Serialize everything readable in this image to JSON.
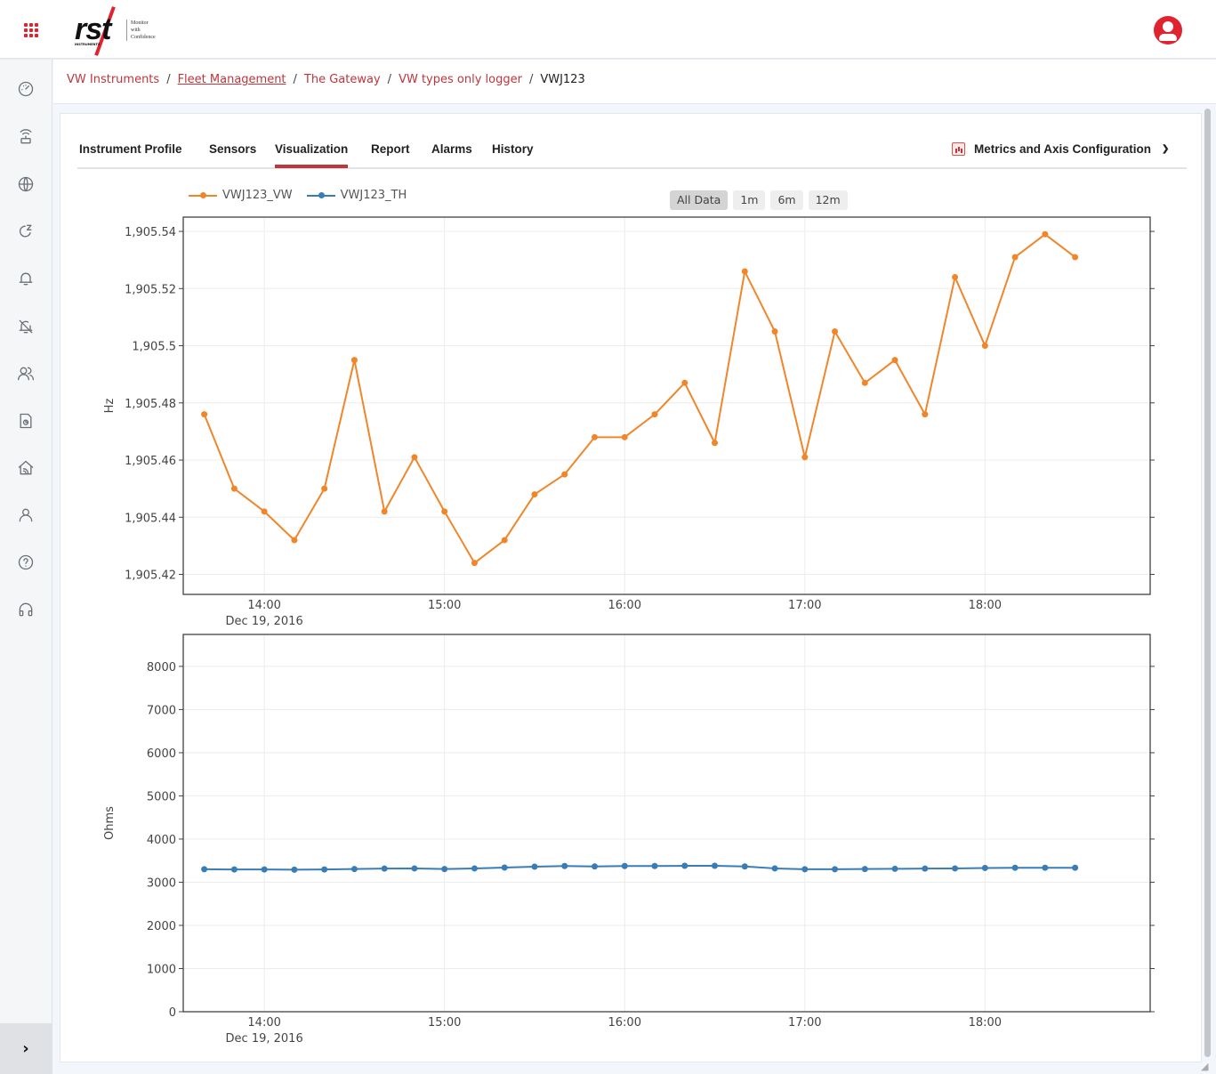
{
  "header": {
    "apps_icon": "grid-icon",
    "logo": {
      "text": "rst",
      "subtext": "INSTRUMENTS",
      "tagline": [
        "Monitor",
        "with",
        "Confidence"
      ]
    },
    "user_icon": "user-circle-icon"
  },
  "sidebar": {
    "items": [
      {
        "id": "dashboard",
        "icon": "gauge-icon"
      },
      {
        "id": "gateway",
        "icon": "router-icon"
      },
      {
        "id": "network",
        "icon": "globe-icon"
      },
      {
        "id": "sleep",
        "icon": "refresh-sleep-icon"
      },
      {
        "id": "alarms",
        "icon": "bell-icon"
      },
      {
        "id": "alarms-off",
        "icon": "bell-off-icon"
      },
      {
        "id": "users",
        "icon": "users-icon"
      },
      {
        "id": "reports",
        "icon": "file-chart-icon"
      },
      {
        "id": "sites",
        "icon": "home-wifi-icon"
      },
      {
        "id": "profile",
        "icon": "user-icon"
      },
      {
        "id": "help",
        "icon": "help-circle-icon"
      },
      {
        "id": "support",
        "icon": "headset-icon"
      }
    ],
    "toggle_label": "›"
  },
  "breadcrumb": [
    {
      "label": "VW Instruments",
      "link": true,
      "underline": false
    },
    {
      "label": "Fleet Management",
      "link": true,
      "underline": true
    },
    {
      "label": "The Gateway",
      "link": true,
      "underline": false
    },
    {
      "label": "VW types only logger",
      "link": true,
      "underline": false
    },
    {
      "label": "VWJ123",
      "link": false,
      "underline": false
    }
  ],
  "tabs": [
    {
      "label": "Instrument Profile",
      "active": false
    },
    {
      "label": "Sensors",
      "active": false
    },
    {
      "label": "Visualization",
      "active": true
    },
    {
      "label": "Report",
      "active": false
    },
    {
      "label": "Alarms",
      "active": false
    },
    {
      "label": "History",
      "active": false
    }
  ],
  "metrics_menu": {
    "label": "Metrics and Axis Configuration",
    "icon": "bar-chart-icon",
    "chevron": "chevron-down-icon"
  },
  "range_buttons": [
    {
      "label": "All Data",
      "selected": true
    },
    {
      "label": "1m",
      "selected": false
    },
    {
      "label": "6m",
      "selected": false
    },
    {
      "label": "12m",
      "selected": false
    }
  ],
  "colors": {
    "accent": "#c0353c",
    "vw": "#f0862a",
    "th": "#3a7db5"
  },
  "chart_data": [
    {
      "type": "line",
      "title": "",
      "xlabel": "",
      "ylabel": "Hz",
      "x_date_label": "Dec 19, 2016",
      "xticks": [
        "14:00",
        "15:00",
        "16:00",
        "17:00",
        "18:00"
      ],
      "xlim": [
        "13:33",
        "18:55"
      ],
      "ylim": [
        1905.413,
        1905.545
      ],
      "yticks": [
        1905.42,
        1905.44,
        1905.46,
        1905.48,
        1905.5,
        1905.52,
        1905.54
      ],
      "ytick_labels": [
        "1,905.42",
        "1,905.44",
        "1,905.46",
        "1,905.48",
        "1,905.5",
        "1,905.52",
        "1,905.54"
      ],
      "grid": true,
      "legend": "top-left",
      "x": [
        "13:40",
        "13:50",
        "14:00",
        "14:10",
        "14:20",
        "14:30",
        "14:40",
        "14:50",
        "15:00",
        "15:10",
        "15:20",
        "15:30",
        "15:40",
        "15:50",
        "16:00",
        "16:10",
        "16:20",
        "16:30",
        "16:40",
        "16:50",
        "17:00",
        "17:10",
        "17:20",
        "17:30",
        "17:40",
        "17:50",
        "18:00",
        "18:10",
        "18:20",
        "18:30"
      ],
      "series": [
        {
          "name": "VWJ123_VW",
          "color": "#f0862a",
          "values": [
            1905.476,
            1905.45,
            1905.442,
            1905.432,
            1905.45,
            1905.495,
            1905.442,
            1905.461,
            1905.442,
            1905.424,
            1905.432,
            1905.448,
            1905.455,
            1905.468,
            1905.468,
            1905.476,
            1905.487,
            1905.466,
            1905.526,
            1905.505,
            1905.461,
            1905.505,
            1905.487,
            1905.495,
            1905.476,
            1905.524,
            1905.5,
            1905.531,
            1905.539,
            1905.531
          ]
        }
      ]
    },
    {
      "type": "line",
      "title": "",
      "xlabel": "",
      "ylabel": "Ohms",
      "x_date_label": "Dec 19, 2016",
      "xticks": [
        "14:00",
        "15:00",
        "16:00",
        "17:00",
        "18:00"
      ],
      "xlim": [
        "13:33",
        "18:55"
      ],
      "ylim": [
        0,
        8740
      ],
      "yticks": [
        0,
        1000,
        2000,
        3000,
        4000,
        5000,
        6000,
        7000,
        8000
      ],
      "ytick_labels": [
        "0",
        "1000",
        "2000",
        "3000",
        "4000",
        "5000",
        "6000",
        "7000",
        "8000"
      ],
      "grid": true,
      "x": [
        "13:40",
        "13:50",
        "14:00",
        "14:10",
        "14:20",
        "14:30",
        "14:40",
        "14:50",
        "15:00",
        "15:10",
        "15:20",
        "15:30",
        "15:40",
        "15:50",
        "16:00",
        "16:10",
        "16:20",
        "16:30",
        "16:40",
        "16:50",
        "17:00",
        "17:10",
        "17:20",
        "17:30",
        "17:40",
        "17:50",
        "18:00",
        "18:10",
        "18:20",
        "18:30"
      ],
      "series": [
        {
          "name": "VWJ123_TH",
          "color": "#3a7db5",
          "values": [
            3300,
            3295,
            3295,
            3290,
            3295,
            3305,
            3315,
            3320,
            3305,
            3320,
            3340,
            3360,
            3375,
            3365,
            3375,
            3375,
            3380,
            3380,
            3365,
            3320,
            3300,
            3300,
            3305,
            3310,
            3315,
            3320,
            3330,
            3335,
            3335,
            3335
          ]
        }
      ]
    }
  ]
}
